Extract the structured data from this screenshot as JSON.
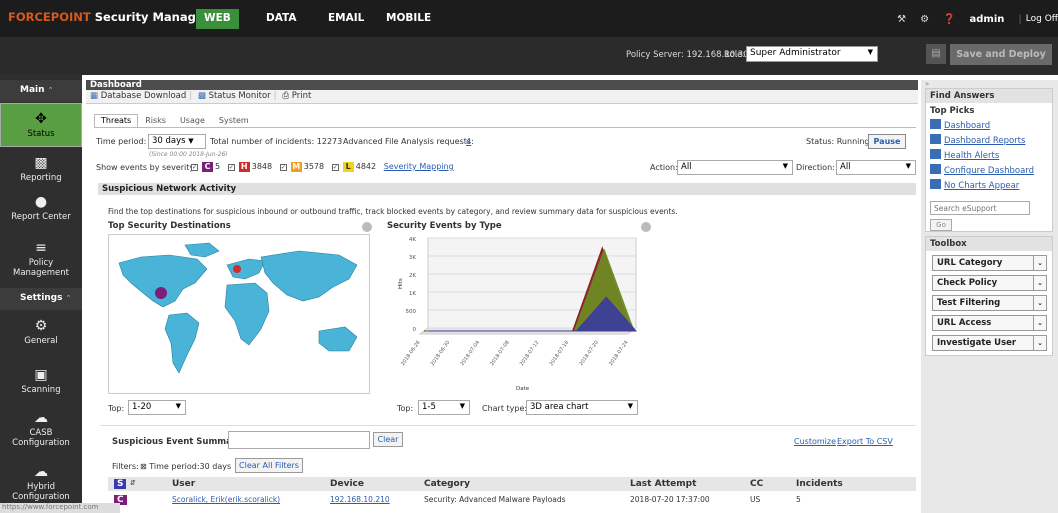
{
  "app": {
    "brand_prefix": "FORCEPOINT",
    "brand_suffix": " Security Manager",
    "nav_tabs": [
      "WEB",
      "DATA",
      "EMAIL",
      "MOBILE"
    ],
    "active_tab": "WEB",
    "user": "admin",
    "logoff": "Log Off"
  },
  "policy": {
    "server": "Policy Server: 192.168.10.30",
    "role_label": "Role:",
    "role_value": "Super Administrator",
    "save_deploy": "Save and Deploy"
  },
  "leftnav": {
    "main_label": "Main",
    "main_items": [
      {
        "label": "Status",
        "icon": "status-icon"
      },
      {
        "label": "Reporting",
        "icon": "bar-chart-icon"
      },
      {
        "label": "Report Center",
        "icon": "report-center-icon"
      },
      {
        "label": "Policy Management",
        "icon": "policy-icon"
      }
    ],
    "settings_label": "Settings",
    "settings_items": [
      {
        "label": "General",
        "icon": "gear-icon"
      },
      {
        "label": "Scanning",
        "icon": "scanning-icon"
      },
      {
        "label": "CASB Configuration",
        "icon": "cloud-icon"
      },
      {
        "label": "Hybrid Configuration",
        "icon": "hybrid-cloud-icon"
      }
    ]
  },
  "dashboard": {
    "title": "Dashboard",
    "toolbar": {
      "db_download": "Database Download",
      "status_monitor": "Status Monitor",
      "print": "Print"
    },
    "tabs": [
      "Threats",
      "Risks",
      "Usage",
      "System"
    ],
    "time_period_label": "Time period:",
    "time_period_value": "30 days",
    "total_incidents": "Total number of incidents: 12273",
    "since": "(Since 00:00 2018-Jun-26)",
    "afa_label": "Advanced File Analysis requests:",
    "afa_value": "4",
    "status_text": "Status: Running",
    "pause": "Pause",
    "severity_label": "Show events by severity:",
    "severity": [
      {
        "code": "C",
        "count": "5",
        "color": "#7a1f7a"
      },
      {
        "code": "H",
        "count": "3848",
        "color": "#d22b2b"
      },
      {
        "code": "M",
        "count": "3578",
        "color": "#f0a020"
      },
      {
        "code": "L",
        "count": "4842",
        "color": "#f2d21c"
      }
    ],
    "severity_mapping": "Severity Mapping",
    "action_label": "Action:",
    "action_value": "All",
    "direction_label": "Direction:",
    "direction_value": "All",
    "section_title": "Suspicious Network Activity",
    "description": "Find the top destinations for suspicious inbound or outbound traffic, track blocked events by category, and review summary data for suspicious events.",
    "top_dest_title": "Top Security Destinations",
    "events_by_type_title": "Security Events by Type",
    "top_left_label": "Top:",
    "top_left_value": "1-20",
    "top_right_label": "Top:",
    "top_right_value": "1-5",
    "chart_type_label": "Chart type:",
    "chart_type_value": "3D area chart",
    "summary_title": "Suspicious Event Summary",
    "clear": "Clear",
    "customize": "Customize",
    "export_csv": "Export To CSV",
    "filters_label": "Filters:",
    "filter_chip": "Time period:30 days",
    "clear_all_filters": "Clear All Filters",
    "columns": [
      "S",
      "User",
      "Device",
      "Category",
      "Last Attempt",
      "CC",
      "Incidents"
    ],
    "row": {
      "sev": "C",
      "user": "Scoralick, Erik(erik.scoralick)",
      "device": "192.168.10.210",
      "category": "Security: Advanced Malware Payloads",
      "last_attempt": "2018-07-20 17:37:00",
      "cc": "US",
      "incidents": "5"
    }
  },
  "rightpanel": {
    "find_answers": "Find Answers",
    "top_picks": "Top Picks",
    "picks": [
      "Dashboard",
      "Dashboard Reports",
      "Health Alerts",
      "Configure Dashboard",
      "No Charts Appear"
    ],
    "search_placeholder": "Search eSupport",
    "go": "Go",
    "toolbox": "Toolbox",
    "tools": [
      "URL Category",
      "Check Policy",
      "Test Filtering",
      "URL Access",
      "Investigate User"
    ]
  },
  "statusbar": "https://www.forcepoint.com",
  "chart_data": {
    "type": "area",
    "title": "Security Events by Type",
    "xlabel": "Date",
    "ylabel": "Hits",
    "y_ticks": [
      "4K",
      "3K",
      "2K",
      "1K",
      "500",
      "0"
    ],
    "x": [
      "2018-06-26",
      "2018-06-30",
      "2018-07-04",
      "2018-07-08",
      "2018-07-12",
      "2018-07-16",
      "2018-07-20",
      "2018-07-24"
    ],
    "series": [
      {
        "values": [
          0,
          0,
          0,
          0,
          0,
          0,
          3700,
          0
        ],
        "color": "#8b1a1a"
      },
      {
        "values": [
          0,
          0,
          0,
          0,
          0,
          0,
          3600,
          0
        ],
        "color": "#6b8e23"
      },
      {
        "values": [
          0,
          0,
          0,
          0,
          0,
          0,
          1500,
          0
        ],
        "color": "#3a3aa0"
      }
    ]
  }
}
